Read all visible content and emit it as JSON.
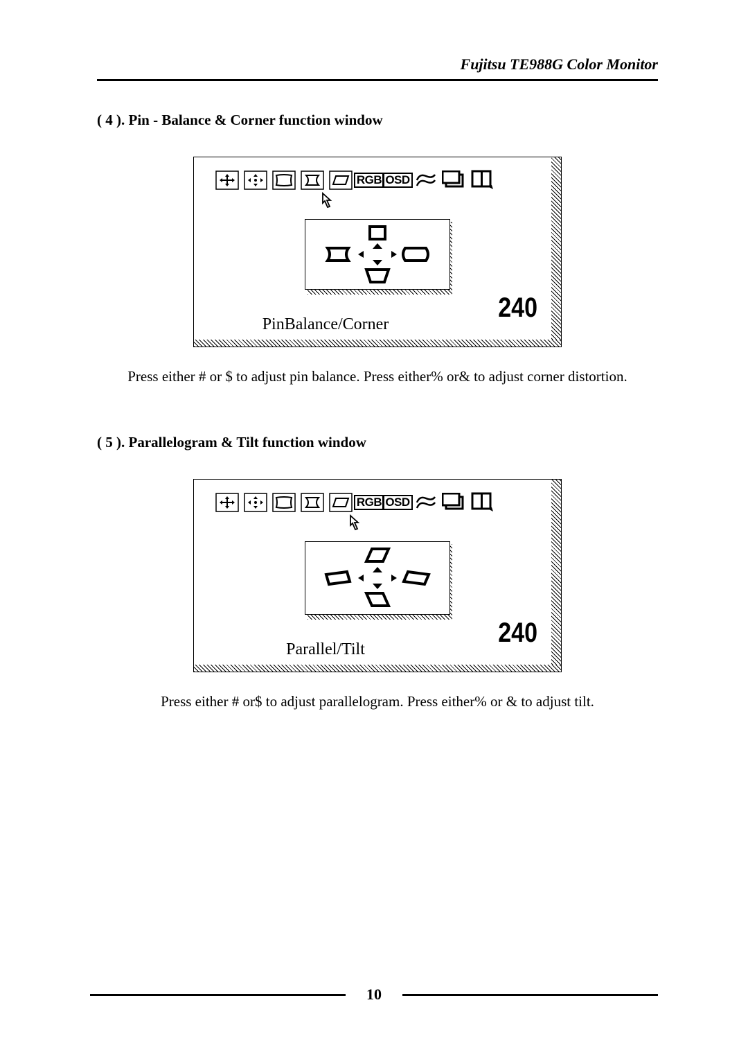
{
  "header": {
    "title": "Fujitsu TE988G Color Monitor"
  },
  "section4": {
    "title": "( 4 ). Pin - Balance & Corner function window",
    "osd_value": "240",
    "caption": "PinBalance/Corner",
    "instruction_prefix": "Press either ",
    "sym1": "#",
    "inst_mid1": " or ",
    "sym2": "$",
    "inst_mid2": "  to adjust pin balance. Press either",
    "sym3": "%",
    "inst_mid3": " or",
    "sym4": "&",
    "inst_end": "  to adjust corner distortion."
  },
  "section5": {
    "title": "( 5 ). Parallelogram & Tilt function window",
    "osd_value": "240",
    "caption": "Parallel/Tilt",
    "instruction_prefix": "Press either ",
    "sym1": "#",
    "inst_mid1": " or",
    "sym2": "$",
    "inst_mid2": "  to adjust parallelogram. Press either",
    "sym3": "%",
    "inst_mid3": " or ",
    "sym4": "&",
    "inst_end": "  to adjust tilt."
  },
  "icon_labels": {
    "rgb": "RGB",
    "osd": "OSD"
  },
  "page_number": "10"
}
